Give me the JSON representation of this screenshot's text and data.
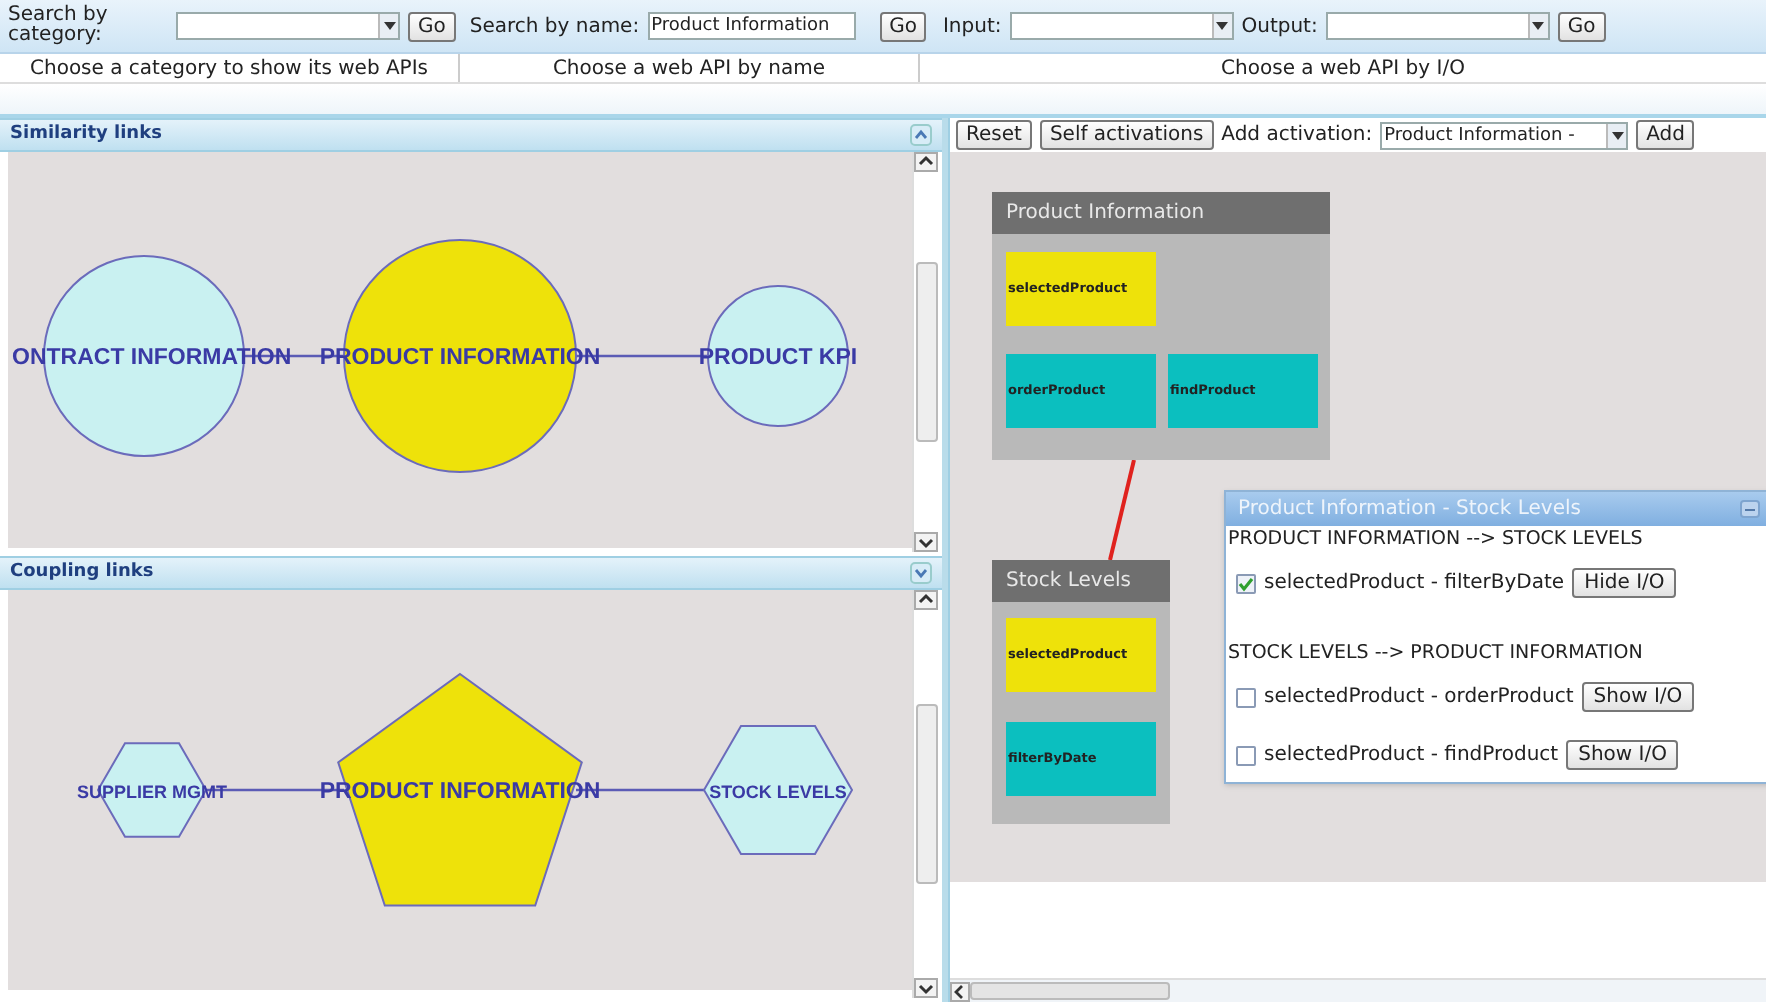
{
  "search": {
    "category_label": "Search by category:",
    "category_button": "Go",
    "name_label": "Search by name:",
    "name_value": "Product Information",
    "name_button": "Go",
    "input_label": "Input:",
    "output_label": "Output:",
    "io_button": "Go"
  },
  "hints": [
    "Choose a category to show its web APIs",
    "Choose a web API by name",
    "Choose a web API by I/O"
  ],
  "similarity_panel": {
    "title": "Similarity links",
    "nodes": [
      {
        "label": "ONTRACT INFORMATION",
        "kind": "circle",
        "selected": false
      },
      {
        "label": "PRODUCT INFORMATION",
        "kind": "circle",
        "selected": true
      },
      {
        "label": "PRODUCT KPI",
        "kind": "circle",
        "selected": false
      }
    ]
  },
  "coupling_panel": {
    "title": "Coupling links",
    "nodes": [
      {
        "label": "SUPPLIER MGMT",
        "kind": "hexagon",
        "selected": false
      },
      {
        "label": "PRODUCT INFORMATION",
        "kind": "pentagon",
        "selected": true
      },
      {
        "label": "STOCK LEVELS",
        "kind": "hexagon",
        "selected": false
      }
    ]
  },
  "toolbar": {
    "reset": "Reset",
    "self_activations": "Self activations",
    "add_label": "Add activation:",
    "add_value": "Product Information -",
    "add": "Add"
  },
  "apis": [
    {
      "title": "Product Information",
      "ports": [
        {
          "label": "selectedProduct",
          "color": "#eee20a"
        },
        {
          "label": "orderProduct",
          "color": "#0bbfbf"
        },
        {
          "label": "findProduct",
          "color": "#0bbfbf"
        }
      ]
    },
    {
      "title": "Stock Levels",
      "ports": [
        {
          "label": "selectedProduct",
          "color": "#eee20a"
        },
        {
          "label": "filterByDate",
          "color": "#0bbfbf"
        }
      ]
    }
  ],
  "popup": {
    "title": "Product Information - Stock Levels",
    "sections": [
      {
        "heading": "PRODUCT INFORMATION --> STOCK LEVELS",
        "rows": [
          {
            "label": "selectedProduct - filterByDate",
            "checked": true,
            "button": "Hide I/O"
          }
        ]
      },
      {
        "heading": "STOCK LEVELS --> PRODUCT INFORMATION",
        "rows": [
          {
            "label": "selectedProduct - orderProduct",
            "checked": false,
            "button": "Show I/O"
          },
          {
            "label": "selectedProduct - findProduct",
            "checked": false,
            "button": "Show I/O"
          }
        ]
      }
    ]
  }
}
